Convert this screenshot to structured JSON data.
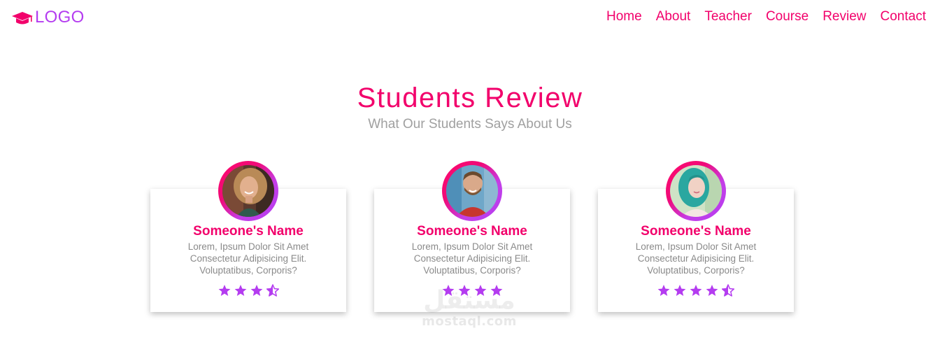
{
  "header": {
    "logo_icon": "graduation-cap-icon",
    "logo_text": "LOGO",
    "nav": [
      "Home",
      "About",
      "Teacher",
      "Course",
      "Review",
      "Contact"
    ]
  },
  "section": {
    "title": "Students Review",
    "subtitle": "What Our Students Says About Us"
  },
  "reviews": [
    {
      "name": "Someone's Name",
      "text": "Lorem, Ipsum Dolor Sit Amet Consectetur Adipisicing Elit. Voluptatibus, Corporis?",
      "rating": 3.5,
      "avatar": "woman-curly-hair-photo"
    },
    {
      "name": "Someone's Name",
      "text": "Lorem, Ipsum Dolor Sit Amet Consectetur Adipisicing Elit. Voluptatibus, Corporis?",
      "rating": 4,
      "avatar": "man-beard-photo"
    },
    {
      "name": "Someone's Name",
      "text": "Lorem, Ipsum Dolor Sit Amet Consectetur Adipisicing Elit. Voluptatibus, Corporis?",
      "rating": 4.5,
      "avatar": "woman-teal-hair-photo"
    }
  ],
  "watermark": {
    "arabic": "مستقل",
    "latin": "mostaql.com"
  },
  "colors": {
    "primary": "#f2006b",
    "accent": "#b43cf0",
    "muted": "#8a8a8a"
  }
}
